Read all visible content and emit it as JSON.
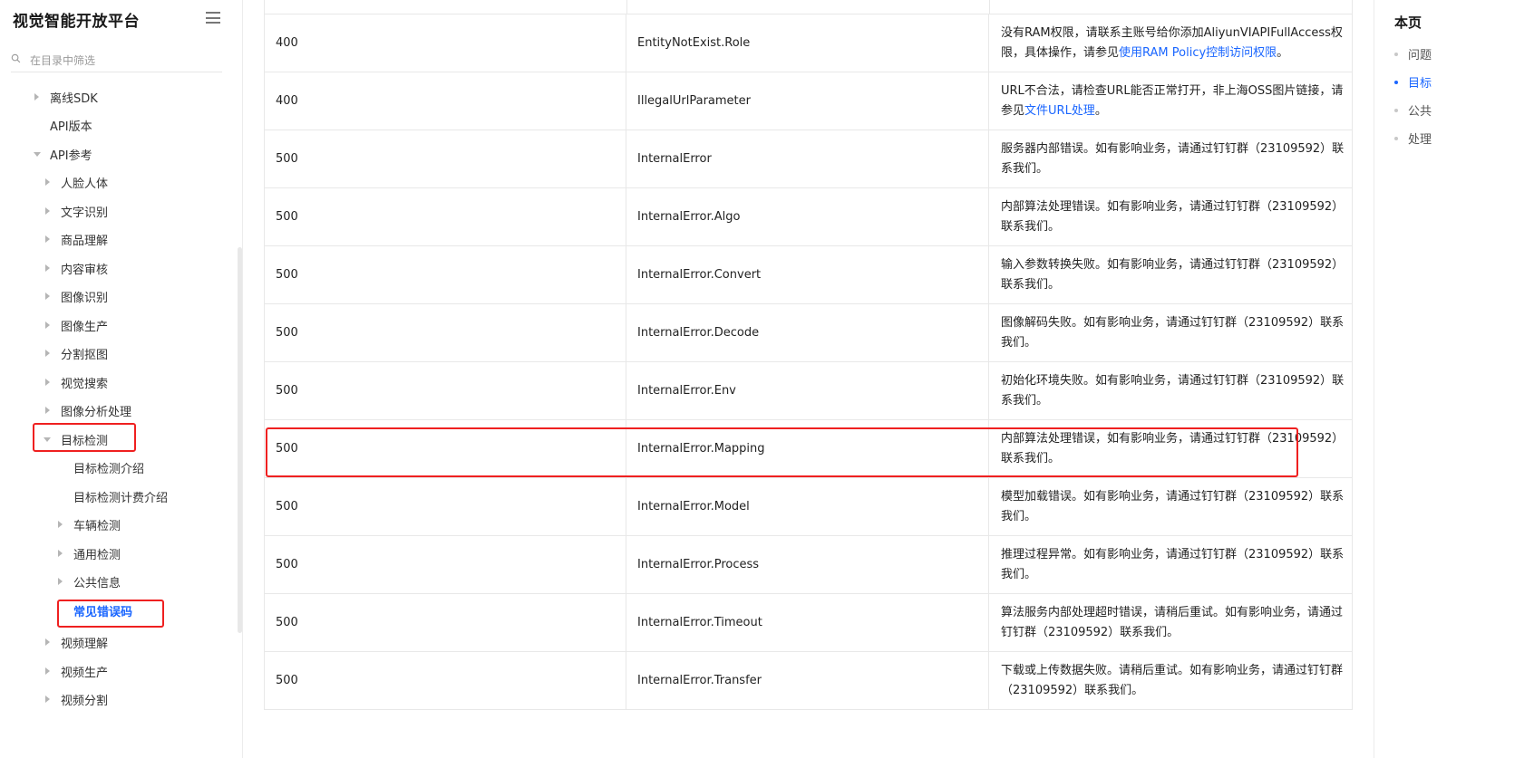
{
  "sidebar": {
    "brand": "视觉智能开放平台",
    "filter_placeholder": "在目录中筛选",
    "items": [
      {
        "label": "离线SDK",
        "caret": "right"
      },
      {
        "label": "API版本",
        "caret": ""
      },
      {
        "label": "API参考",
        "caret": "down"
      },
      {
        "label": "人脸人体",
        "caret": "right"
      },
      {
        "label": "文字识别",
        "caret": "right"
      },
      {
        "label": "商品理解",
        "caret": "right"
      },
      {
        "label": "内容审核",
        "caret": "right"
      },
      {
        "label": "图像识别",
        "caret": "right"
      },
      {
        "label": "图像生产",
        "caret": "right"
      },
      {
        "label": "分割抠图",
        "caret": "right"
      },
      {
        "label": "视觉搜索",
        "caret": "right"
      },
      {
        "label": "图像分析处理",
        "caret": "right"
      },
      {
        "label": "目标检测",
        "caret": "down"
      },
      {
        "label": "目标检测介绍",
        "caret": ""
      },
      {
        "label": "目标检测计费介绍",
        "caret": ""
      },
      {
        "label": "车辆检测",
        "caret": "right"
      },
      {
        "label": "通用检测",
        "caret": "right"
      },
      {
        "label": "公共信息",
        "caret": "right"
      },
      {
        "label": "常见错误码",
        "caret": "",
        "active": true
      },
      {
        "label": "视频理解",
        "caret": "right"
      },
      {
        "label": "视频生产",
        "caret": "right"
      },
      {
        "label": "视频分割",
        "caret": "right"
      }
    ]
  },
  "table": {
    "rows": [
      {
        "code": "400",
        "error": "EntityNotExist.Role",
        "desc": "没有RAM权限，请联系主账号给你添加AliyunVIAPIFullAccess权限，具体操作，请参见",
        "link": "使用RAM Policy控制访问权限",
        "after": "。"
      },
      {
        "code": "400",
        "error": "IllegalUrlParameter",
        "desc": "URL不合法，请检查URL能否正常打开，非上海OSS图片链接，请参见",
        "link": "文件URL处理",
        "after": "。"
      },
      {
        "code": "500",
        "error": "InternalError",
        "desc": "服务器内部错误。如有影响业务，请通过钉钉群（23109592）联系我们。",
        "link": "",
        "after": ""
      },
      {
        "code": "500",
        "error": "InternalError.Algo",
        "desc": "内部算法处理错误。如有影响业务，请通过钉钉群（23109592）联系我们。",
        "link": "",
        "after": ""
      },
      {
        "code": "500",
        "error": "InternalError.Convert",
        "desc": "输入参数转换失败。如有影响业务，请通过钉钉群（23109592）联系我们。",
        "link": "",
        "after": ""
      },
      {
        "code": "500",
        "error": "InternalError.Decode",
        "desc": "图像解码失败。如有影响业务，请通过钉钉群（23109592）联系我们。",
        "link": "",
        "after": ""
      },
      {
        "code": "500",
        "error": "InternalError.Env",
        "desc": "初始化环境失败。如有影响业务，请通过钉钉群（23109592）联系我们。",
        "link": "",
        "after": ""
      },
      {
        "code": "500",
        "error": "InternalError.Mapping",
        "desc": "内部算法处理错误，如有影响业务，请通过钉钉群（23109592）联系我们。",
        "link": "",
        "after": ""
      },
      {
        "code": "500",
        "error": "InternalError.Model",
        "desc": "模型加载错误。如有影响业务，请通过钉钉群（23109592）联系我们。",
        "link": "",
        "after": ""
      },
      {
        "code": "500",
        "error": "InternalError.Process",
        "desc": "推理过程异常。如有影响业务，请通过钉钉群（23109592）联系我们。",
        "link": "",
        "after": ""
      },
      {
        "code": "500",
        "error": "InternalError.Timeout",
        "desc": "算法服务内部处理超时错误，请稍后重试。如有影响业务，请通过钉钉群（23109592）联系我们。",
        "link": "",
        "after": ""
      },
      {
        "code": "500",
        "error": "InternalError.Transfer",
        "desc": "下载或上传数据失败。请稍后重试。如有影响业务，请通过钉钉群（23109592）联系我们。",
        "link": "",
        "after": ""
      }
    ]
  },
  "toc": {
    "title": "本页",
    "items": [
      {
        "label": "问题",
        "active": false
      },
      {
        "label": "目标",
        "active": true
      },
      {
        "label": "公共",
        "active": false
      },
      {
        "label": "处理",
        "active": false
      }
    ]
  },
  "colors": {
    "accent": "#1a66ff",
    "highlight": "#ef2020"
  }
}
